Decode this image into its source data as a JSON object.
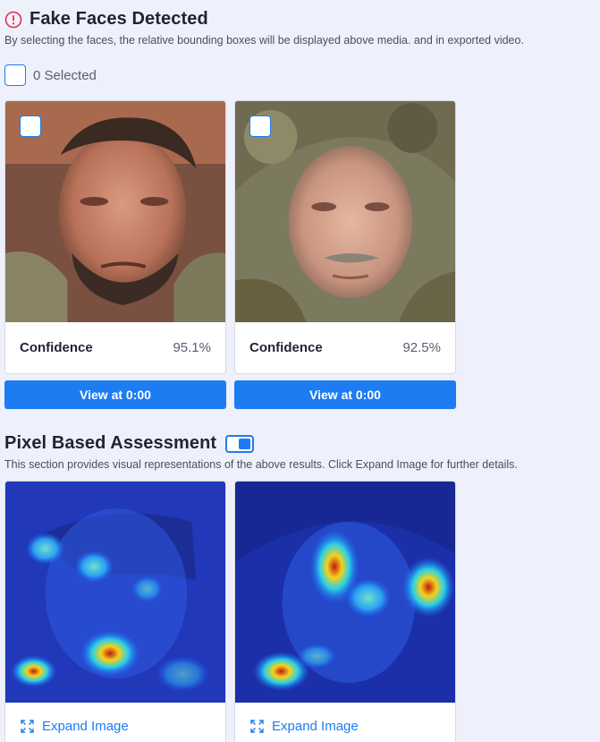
{
  "fake_faces": {
    "title": "Fake Faces Detected",
    "icon": "alert-circle-icon",
    "description": "By selecting the faces, the relative bounding boxes will be displayed above media. and in exported video.",
    "selected_label": "0 Selected",
    "faces": [
      {
        "confidence_label": "Confidence",
        "confidence_value": "95.1%",
        "button_label": "View at 0:00"
      },
      {
        "confidence_label": "Confidence",
        "confidence_value": "92.5%",
        "button_label": "View at 0:00"
      }
    ]
  },
  "pixel_assessment": {
    "title": "Pixel Based Assessment",
    "toggle_on": true,
    "description": "This section provides visual representations of the above results. Click Expand Image for further details.",
    "images": [
      {
        "expand_label": "Expand Image",
        "icon": "expand-icon"
      },
      {
        "expand_label": "Expand Image",
        "icon": "expand-icon"
      }
    ]
  },
  "colors": {
    "accent": "#1d7cf2",
    "alert": "#e0344a",
    "background": "#eef0fb"
  }
}
